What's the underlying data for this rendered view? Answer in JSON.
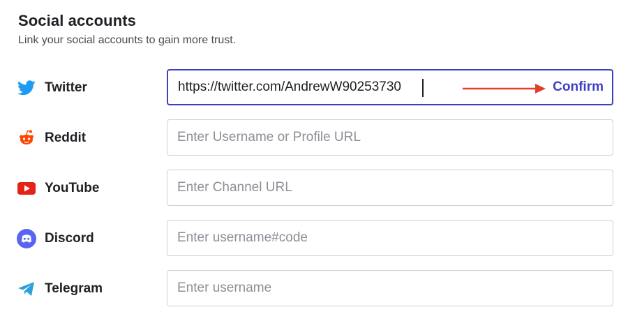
{
  "section": {
    "title": "Social accounts",
    "subtitle": "Link your social accounts to gain more trust."
  },
  "accounts": [
    {
      "name": "Twitter",
      "icon": "twitter-icon",
      "value": "https://twitter.com/AndrewW90253730",
      "placeholder": "",
      "action": "Confirm",
      "color": "#1d9bf0"
    },
    {
      "name": "Reddit",
      "icon": "reddit-icon",
      "value": "",
      "placeholder": "Enter Username or Profile URL",
      "color": "#ff4500"
    },
    {
      "name": "YouTube",
      "icon": "youtube-icon",
      "value": "",
      "placeholder": "Enter Channel URL",
      "color": "#e62117"
    },
    {
      "name": "Discord",
      "icon": "discord-icon",
      "value": "",
      "placeholder": "Enter username#code",
      "color": "#5865f2"
    },
    {
      "name": "Telegram",
      "icon": "telegram-icon",
      "value": "",
      "placeholder": "Enter username",
      "color": "#2f9fdb"
    }
  ],
  "colors": {
    "accent": "#3d3fc6",
    "annotation_arrow": "#e0402a"
  }
}
